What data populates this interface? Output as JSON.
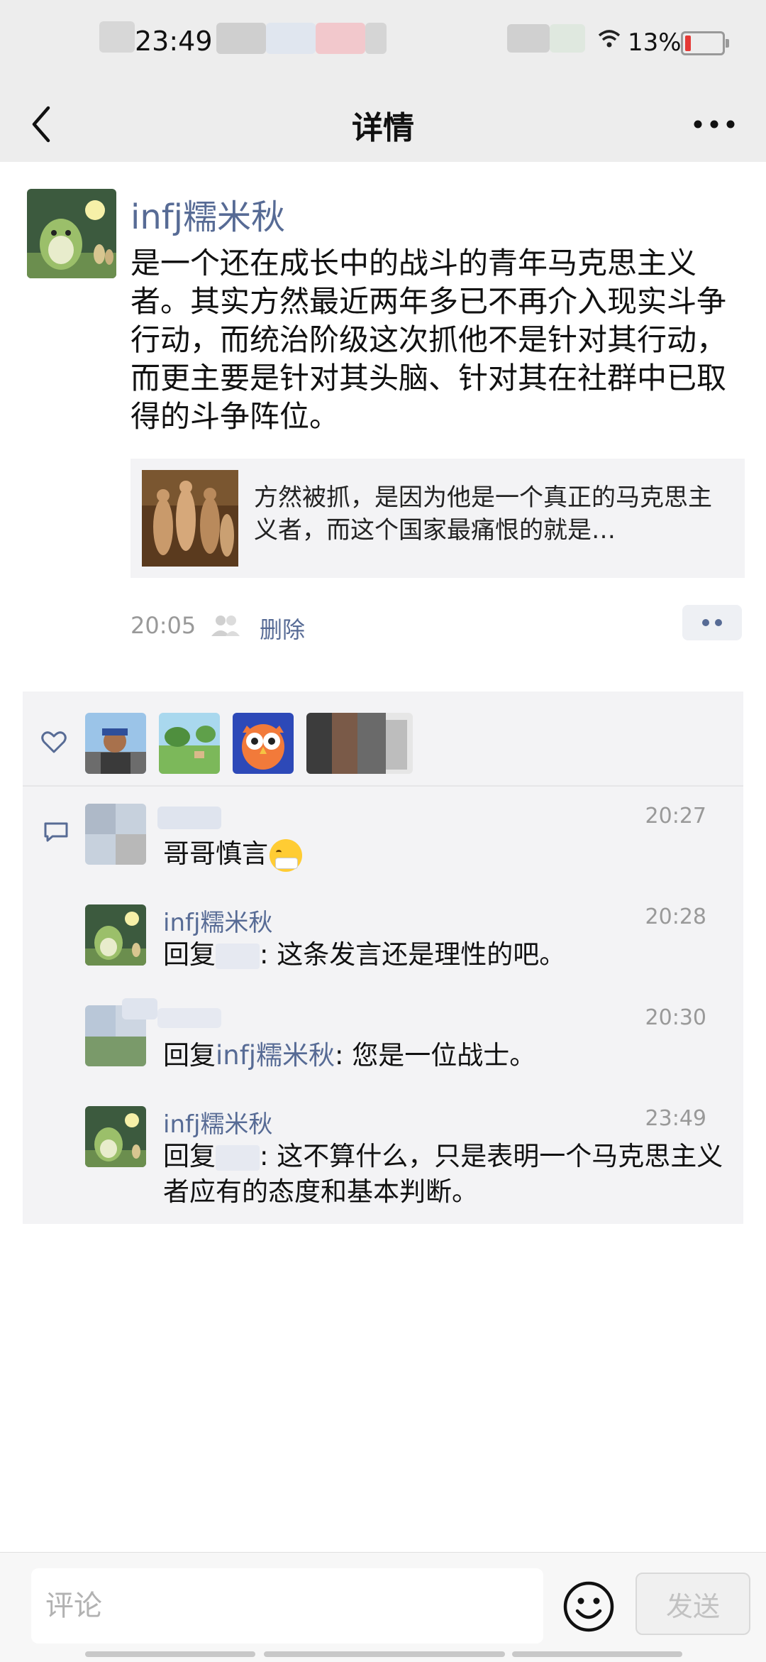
{
  "status_bar": {
    "time": "23:49",
    "battery": "13%"
  },
  "nav": {
    "title": "详情"
  },
  "post": {
    "author": "infj糯米秋",
    "text": "是一个还在成长中的战斗的青年马克思主义者。其实方然最近两年多已不再介入现实斗争行动，而统治阶级这次抓他不是针对其行动，而更主要是针对其头脑、针对其在社群中已取得的斗争阵位。",
    "link_text": "方然被抓，是因为他是一个真正的马克思主义者，而这个国家最痛恨的就是…",
    "time": "20:05",
    "delete_label": "删除"
  },
  "comments": [
    {
      "name": "",
      "time": "20:27",
      "text": "哥哥慎言"
    },
    {
      "name": "infj糯米秋",
      "time": "20:28",
      "prefix": "回复",
      "suffix": ": 这条发言还是理性的吧。"
    },
    {
      "name": "",
      "time": "20:30",
      "prefix": "回复",
      "ref": "infj糯米秋",
      "suffix": ": 您是一位战士。"
    },
    {
      "name": "infj糯米秋",
      "time": "23:49",
      "prefix": "回复",
      "suffix": ": 这不算什么，只是表明一个马克思主义者应有的态度和基本判断。"
    }
  ],
  "input": {
    "placeholder": "评论",
    "send_label": "发送"
  },
  "icons": {
    "back": "chevron-left-icon",
    "more": "more-horizontal-icon",
    "like": "heart-icon",
    "comment": "comment-icon",
    "emoji": "smiley-icon",
    "friends": "friends-icon"
  },
  "colors": {
    "name_blue": "#576b95",
    "battery_low": "#e53935",
    "header_bg": "#ededed"
  }
}
